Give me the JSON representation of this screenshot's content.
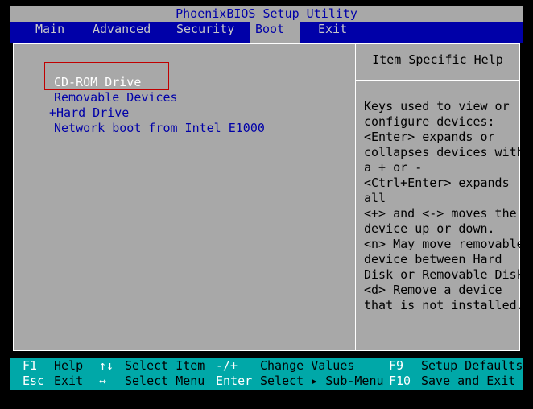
{
  "title": "PhoenixBIOS Setup Utility",
  "menu": [
    {
      "label": "Main"
    },
    {
      "label": "Advanced"
    },
    {
      "label": "Security"
    },
    {
      "label": "Boot"
    },
    {
      "label": "Exit"
    }
  ],
  "active_menu": "Boot",
  "boot_items": [
    "CD-ROM Drive",
    "Removable Devices",
    "+Hard Drive",
    "Network boot from Intel E1000"
  ],
  "help": {
    "title": "Item Specific Help",
    "lines": [
      "Keys used to view or",
      "configure devices:",
      "<Enter> expands or",
      "collapses devices with",
      "a + or -",
      "<Ctrl+Enter> expands",
      "all",
      "<+> and <-> moves the",
      "device up or down.",
      "<n> May move removable",
      "device between Hard",
      "Disk or Removable Disk",
      "<d> Remove a device",
      "that is not installed."
    ]
  },
  "footer": {
    "row1": [
      {
        "key": "F1",
        "desc": "Help"
      },
      {
        "key": "↑↓",
        "desc": "Select Item"
      },
      {
        "key": "-/+",
        "desc": "Change Values"
      },
      {
        "key": "F9",
        "desc": "Setup Defaults"
      }
    ],
    "row2": [
      {
        "key": "Esc",
        "desc": "Exit"
      },
      {
        "key": "↔",
        "desc": "Select Menu"
      },
      {
        "key": "Enter",
        "desc": "Select ▸ Sub-Menu"
      },
      {
        "key": "F10",
        "desc": "Save and Exit"
      }
    ]
  },
  "colors": {
    "bios_blue": "#0000a8",
    "bios_gray": "#a8a8a8",
    "footer_cyan": "#00a8a8",
    "selection_outline": "#c00000"
  }
}
